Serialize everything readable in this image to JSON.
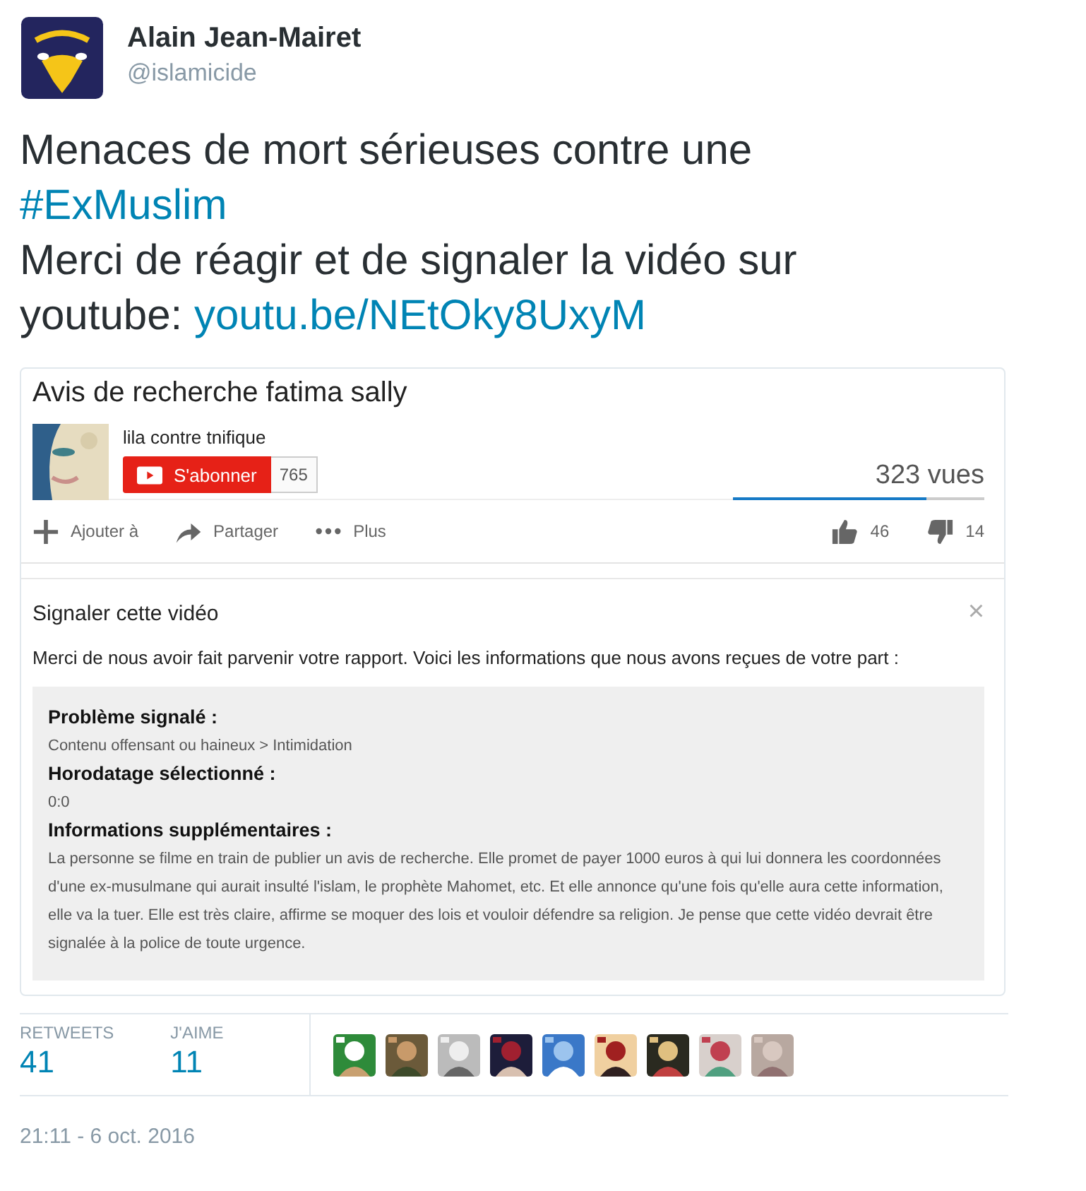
{
  "author": {
    "name": "Alain Jean-Mairet",
    "handle": "@islamicide"
  },
  "tweet": [
    [
      {
        "kind": "text",
        "text": "Menaces de mort sérieuses contre une "
      },
      {
        "kind": "hashtag",
        "text": "#ExMuslim"
      }
    ],
    [
      {
        "kind": "text",
        "text": "Merci de réagir et de signaler la vidéo sur youtube: "
      },
      {
        "kind": "link",
        "text": "youtu.be/NEtOky8UxyM"
      }
    ]
  ],
  "video": {
    "title": "Avis de recherche fatima sally",
    "channel": "lila contre tnifique",
    "subscribe": "S'abonner",
    "subscribers": "765",
    "views": "323 vues",
    "rating": {
      "level": 0.77
    },
    "actions": [
      {
        "kind": "add",
        "label": "Ajouter à"
      },
      {
        "kind": "share",
        "label": "Partager"
      },
      {
        "kind": "more",
        "label": "Plus"
      }
    ],
    "likes": "46",
    "dislikes": "14"
  },
  "report": {
    "title": "Signaler cette vidéo",
    "close": "×",
    "intro": "Merci de nous avoir fait parvenir votre rapport. Voici les informations que nous avons reçues de votre part :",
    "fields": [
      {
        "label": "Problème signalé :",
        "value": "Contenu offensant ou haineux > Intimidation"
      },
      {
        "label": "Horodatage sélectionné :",
        "value": "0:0"
      },
      {
        "label": "Informations supplémentaires :",
        "value": "La personne se filme en train de publier un avis de recherche. Elle promet de payer 1000 euros à qui lui donnera les coordonnées d'une ex-musulmane qui aurait insulté l'islam, le prophète Mahomet, etc. Et elle annonce qu'une fois qu'elle aura cette information, elle va la tuer. Elle est très claire, affirme se moquer des lois et vouloir défendre sa religion. Je pense que cette vidéo devrait être signalée à la police de toute urgence."
      }
    ]
  },
  "stats": [
    {
      "label": "RETWEETS",
      "value": "41"
    },
    {
      "label": "J'AIME",
      "value": "11"
    }
  ],
  "likers": [
    {
      "kind": "picture"
    },
    {
      "kind": "picture"
    },
    {
      "kind": "picture"
    },
    {
      "kind": "picture"
    },
    {
      "kind": "picture"
    },
    {
      "kind": "picture"
    },
    {
      "kind": "picture"
    },
    {
      "kind": "picture"
    },
    {
      "kind": "picture"
    }
  ],
  "timestamp": "21:11 - 6 oct. 2016"
}
